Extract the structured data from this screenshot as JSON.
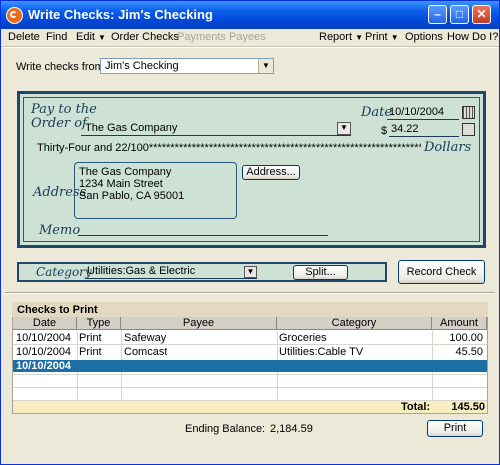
{
  "window": {
    "title": "Write Checks: Jim's Checking"
  },
  "menu": {
    "delete": "Delete",
    "find": "Find",
    "edit": "Edit",
    "order_checks": "Order Checks",
    "payments": "Payments",
    "payees": "Payees",
    "report": "Report",
    "print": "Print",
    "options": "Options",
    "how_do_i": "How Do I?"
  },
  "write_from": {
    "label": "Write checks from:",
    "value": "Jim's Checking"
  },
  "check": {
    "pay_to_line1": "Pay to the",
    "pay_to_line2": "Order of",
    "payee": "The Gas Company",
    "date_label": "Date",
    "date": "10/10/2004",
    "dollar_sign": "$",
    "amount": "34.22",
    "amount_words": "Thirty-Four and 22/100*********************************************************************",
    "dollars_label": "Dollars",
    "address_label": "Address",
    "address_lines": [
      "The Gas Company",
      "1234 Main Street",
      "San Pablo, CA 95001"
    ],
    "address_button": "Address...",
    "memo_label": "Memo",
    "memo": ""
  },
  "category": {
    "label": "Category",
    "value": "Utilities:Gas & Electric",
    "split_button": "Split..."
  },
  "record_button": "Record Check",
  "checks_to_print": {
    "title": "Checks to Print",
    "columns": [
      "Date",
      "Type",
      "Payee",
      "Category",
      "Amount"
    ],
    "rows": [
      {
        "date": "10/10/2004",
        "type": "Print",
        "payee": "Safeway",
        "category": "Groceries",
        "amount": "100.00"
      },
      {
        "date": "10/10/2004",
        "type": "Print",
        "payee": "Comcast",
        "category": "Utilities:Cable TV",
        "amount": "45.50"
      },
      {
        "date": "10/10/2004",
        "type": "",
        "payee": "",
        "category": "",
        "amount": ""
      }
    ],
    "total_label": "Total:",
    "total": "145.50"
  },
  "ending_balance": {
    "label": "Ending Balance:",
    "value": "2,184.59"
  },
  "print_button": "Print",
  "colors": {
    "titlebar": "#0a5fe9",
    "check_bg": "#cde2d5",
    "check_border": "#1f466c",
    "selected_row": "#1c6fa5",
    "total_bar": "#f6eebe"
  }
}
